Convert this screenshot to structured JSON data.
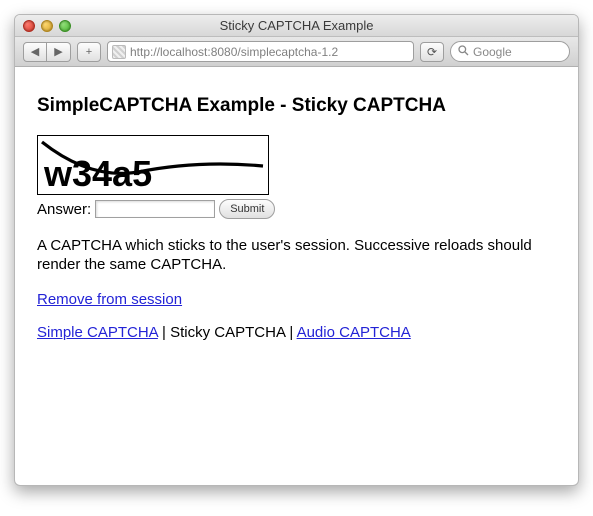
{
  "window": {
    "title": "Sticky CAPTCHA Example"
  },
  "toolbar": {
    "back": "◀",
    "forward": "▶",
    "add": "+",
    "url": "http://localhost:8080/simplecaptcha-1.2",
    "reload": "⟳",
    "search_icon": "🔍",
    "search_placeholder": "Google"
  },
  "page": {
    "heading": "SimpleCAPTCHA Example - Sticky CAPTCHA",
    "captcha_text": "w34a5",
    "answer_label": "Answer:",
    "answer_value": "",
    "submit_label": "Submit",
    "description": "A CAPTCHA which sticks to the user's session. Successive reloads should render the same CAPTCHA.",
    "remove_link": "Remove from session",
    "nav": {
      "simple": "Simple CAPTCHA",
      "sticky": "Sticky CAPTCHA",
      "audio": "Audio CAPTCHA",
      "sep": " | "
    }
  }
}
